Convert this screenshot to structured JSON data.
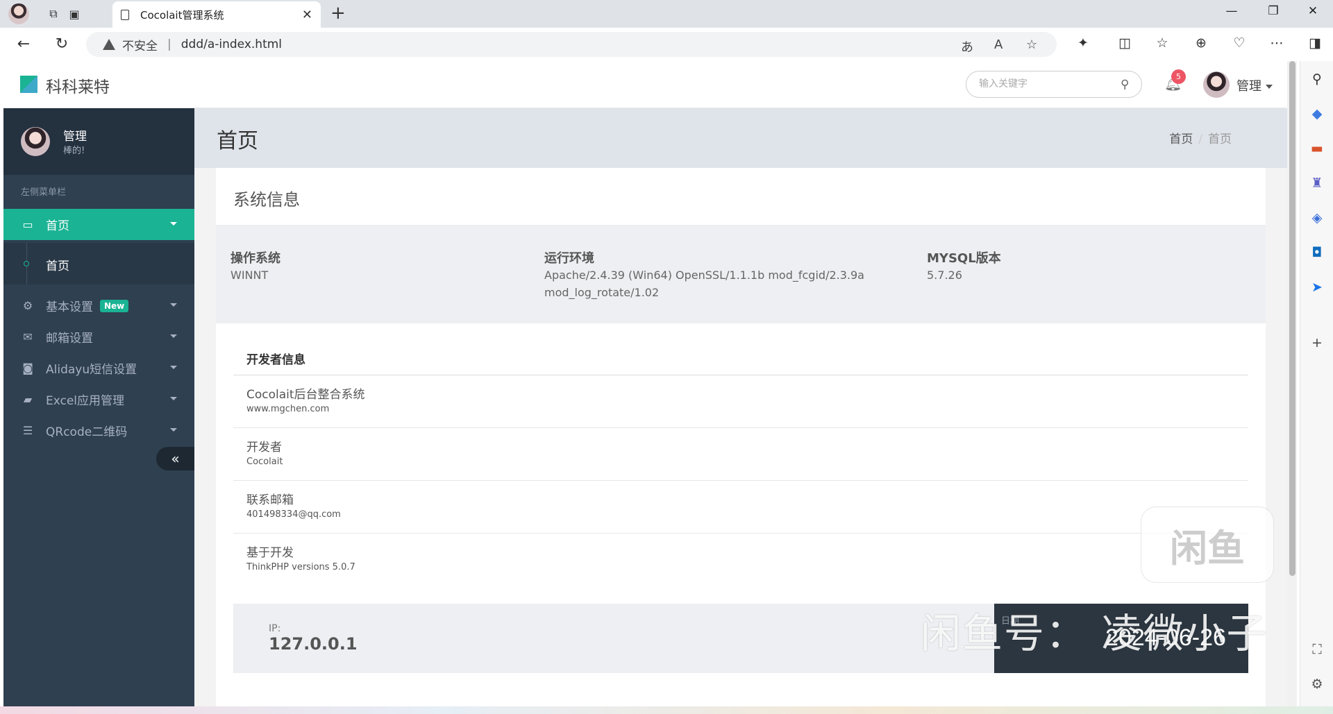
{
  "browser": {
    "tab_title": "Cocolait管理系统",
    "security_label": "不安全",
    "url": "ddd/a-index.html",
    "window_controls": {
      "minimize": "—",
      "restore": "❐",
      "close": "✕"
    }
  },
  "header": {
    "logo_text": "科科莱特",
    "search_placeholder": "输入关键字",
    "notification_count": "5",
    "user_name": "管理"
  },
  "sidebar": {
    "profile": {
      "name": "管理",
      "subtitle": "棒的!"
    },
    "caption": "左侧菜单栏",
    "items": [
      {
        "label": "首页",
        "icon": "laptop-icon",
        "active": true
      },
      {
        "label": "基本设置",
        "icon": "gear-icon",
        "badge": "New"
      },
      {
        "label": "邮箱设置",
        "icon": "envelope-icon"
      },
      {
        "label": "Alidayu短信设置",
        "icon": "rss-icon"
      },
      {
        "label": "Excel应用管理",
        "icon": "folder-open-icon"
      },
      {
        "label": "QRcode二维码",
        "icon": "html5-icon"
      }
    ],
    "submenu": [
      {
        "label": "首页"
      }
    ],
    "collapse_symbol": "«"
  },
  "main": {
    "page_title": "首页",
    "breadcrumb": [
      "首页",
      "首页"
    ],
    "card_title": "系统信息",
    "system": [
      {
        "label": "操作系统",
        "value": "WINNT"
      },
      {
        "label": "运行环境",
        "value": "Apache/2.4.39 (Win64) OpenSSL/1.1.1b mod_fcgid/2.3.9a mod_log_rotate/1.02"
      },
      {
        "label": "MYSQL版本",
        "value": "5.7.26"
      }
    ],
    "developer": {
      "title": "开发者信息",
      "rows": [
        {
          "title": "Cocolait后台整合系统",
          "sub": "www.mgchen.com"
        },
        {
          "title": "开发者",
          "sub": "Cocolait"
        },
        {
          "title": "联系邮箱",
          "sub": "401498334@qq.com"
        },
        {
          "title": "基于开发",
          "sub": "ThinkPHP versions 5.0.7"
        }
      ]
    },
    "ip": {
      "label": "IP:",
      "value": "127.0.0.1"
    },
    "date": {
      "label": "日期",
      "value": "2024-06-26"
    }
  },
  "overlay": {
    "watermark_text": "闲鱼号： 凌微小子",
    "watermark_logo": "闲鱼"
  }
}
